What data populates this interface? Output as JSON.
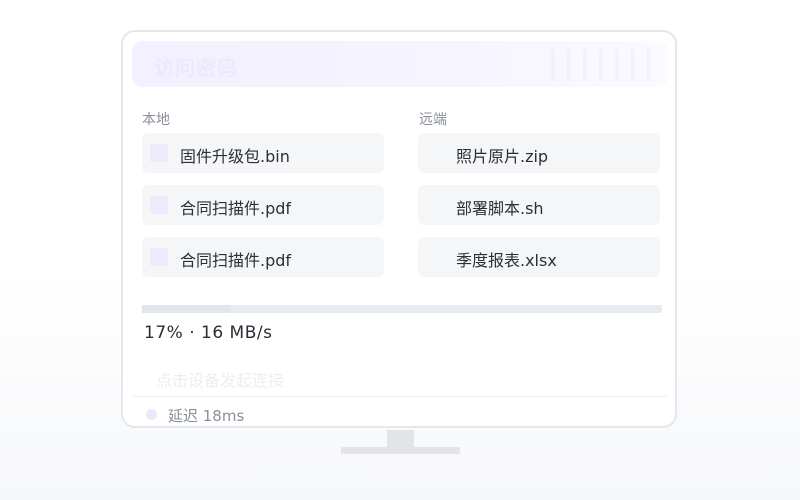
{
  "header": {
    "title": "访问密码"
  },
  "local": {
    "label": "本地",
    "files": [
      {
        "name": "固件升级包.bin"
      },
      {
        "name": "合同扫描件.pdf"
      },
      {
        "name": "合同扫描件.pdf"
      }
    ]
  },
  "remote": {
    "label": "远端",
    "files": [
      {
        "name": "照片原片.zip"
      },
      {
        "name": "部署脚本.sh"
      },
      {
        "name": "季度报表.xlsx"
      }
    ]
  },
  "transfer": {
    "progress": 0.17,
    "status_text": "17% · 16 MB/s"
  },
  "hint": {
    "connect_text": "点击设备发起连接"
  },
  "footer": {
    "latency_text": "延迟 18ms"
  },
  "icons": {
    "file": "file-icon",
    "status": "status-dot-icon"
  },
  "colors": {
    "accent_light": "#efeafc",
    "title_bar": "#f3f0ff",
    "text_primary": "#2b2f36",
    "text_secondary": "#8a9099"
  }
}
